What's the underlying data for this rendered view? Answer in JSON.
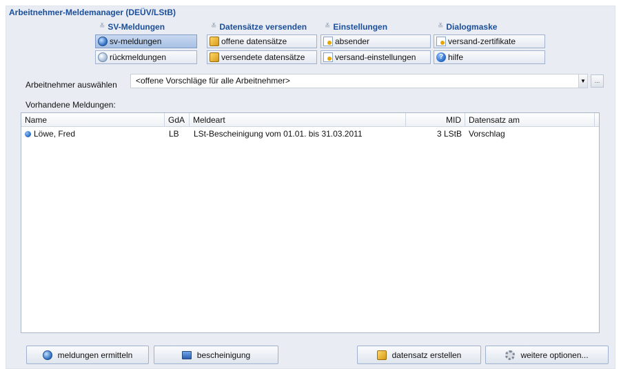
{
  "app_title": "Arbeitnehmer-Meldemanager (DEÜV/LStB)",
  "menu": {
    "groups": [
      {
        "header": "SV-Meldungen",
        "items": [
          {
            "label": "sv-meldungen",
            "icon": "globe-icon",
            "active": true
          },
          {
            "label": "rückmeldungen",
            "icon": "globe-icon"
          }
        ]
      },
      {
        "header": "Datensätze versenden",
        "items": [
          {
            "label": "offene datensätze",
            "icon": "box-icon"
          },
          {
            "label": "versendete datensätze",
            "icon": "box-icon"
          }
        ]
      },
      {
        "header": "Einstellungen",
        "items": [
          {
            "label": "absender",
            "icon": "certificate-icon"
          },
          {
            "label": "versand-einstellungen",
            "icon": "certificate-icon"
          }
        ]
      },
      {
        "header": "Dialogmaske",
        "items": [
          {
            "label": "versand-zertifikate",
            "icon": "certificate-icon"
          },
          {
            "label": "hilfe",
            "icon": "help-icon"
          }
        ]
      }
    ]
  },
  "selector": {
    "label": "Arbeitnehmer auswählen",
    "value": "<offene Vorschläge für alle Arbeitnehmer>",
    "more_label": "..."
  },
  "list_label": "Vorhandene Meldungen:",
  "table": {
    "columns": [
      "Name",
      "GdA",
      "Meldeart",
      "MID",
      "Datensatz am"
    ],
    "rows": [
      {
        "name": "Löwe, Fred",
        "gda": "LB",
        "meldeart": "LSt-Bescheinigung vom 01.01. bis 31.03.2011",
        "mid": "3 LStB",
        "datensatz": "Vorschlag"
      }
    ]
  },
  "buttons": {
    "meldungen_ermitteln": "meldungen ermitteln",
    "bescheinigung": "bescheinigung",
    "datensatz_erstellen": "datensatz erstellen",
    "weitere_optionen": "weitere optionen..."
  }
}
